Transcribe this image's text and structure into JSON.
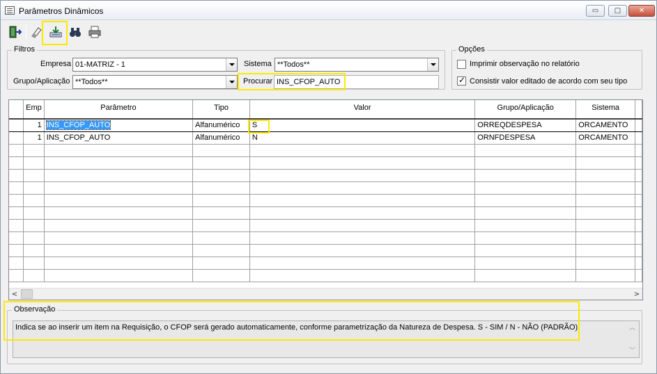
{
  "window": {
    "title": "Parâmetros Dinâmicos",
    "buttons": {
      "minimize": "▭",
      "maximize": "□",
      "close": "✕"
    }
  },
  "toolbar": {
    "items": [
      {
        "name": "exit-icon",
        "tooltip": ""
      },
      {
        "name": "eraser-icon",
        "tooltip": ""
      },
      {
        "name": "edit-record-icon",
        "tooltip": ""
      },
      {
        "name": "search-binoculars-icon",
        "tooltip": ""
      },
      {
        "name": "print-icon",
        "tooltip": ""
      }
    ]
  },
  "filters": {
    "legend": "Filtros",
    "empresa_label": "Empresa",
    "empresa_value": "01-MATRIZ - 1",
    "sistema_label": "Sistema",
    "sistema_value": "**Todos**",
    "grupo_label": "Grupo/Aplicação",
    "grupo_value": "**Todos**",
    "procurar_label": "Procurar",
    "procurar_value": "INS_CFOP_AUTO"
  },
  "options": {
    "legend": "Opções",
    "opt1_label": "Imprimir observação no relatório",
    "opt1_checked": false,
    "opt2_label": "Consistir valor editado de acordo com seu tipo",
    "opt2_checked": true
  },
  "grid": {
    "columns": [
      "Emp",
      "Parâmetro",
      "Tipo",
      "Valor",
      "Grupo/Aplicação",
      "Sistema"
    ],
    "rows": [
      {
        "emp": "1",
        "parametro": "INS_CFOP_AUTO",
        "tipo": "Alfanumérico",
        "valor": "S",
        "grupo": "ORREQDESPESA",
        "sistema": "ORCAMENTO"
      },
      {
        "emp": "1",
        "parametro": "INS_CFOP_AUTO",
        "tipo": "Alfanumérico",
        "valor": "N",
        "grupo": "ORNFDESPESA",
        "sistema": "ORCAMENTO"
      }
    ],
    "scroll_left": "<",
    "scroll_right": ">"
  },
  "observacao": {
    "legend": "Observação",
    "text": "Indica se ao inserir um item na Requisição, o CFOP será gerado automaticamente, conforme parametrização da Natureza de Despesa. S - SIM / N - NÃO (PADRÃO)."
  },
  "colors": {
    "highlight": "#ffe800",
    "selection": "#3399ff"
  }
}
